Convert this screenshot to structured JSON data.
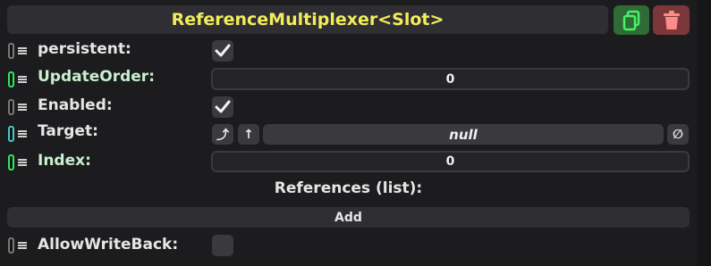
{
  "header": {
    "title": "ReferenceMultiplexer<Slot>",
    "duplicate_icon": "duplicate-icon",
    "delete_icon": "trash-icon"
  },
  "fields": {
    "persistent": {
      "label": "persistent:",
      "checked": true
    },
    "update_order": {
      "label": "UpdateOrder:",
      "value": "0"
    },
    "enabled": {
      "label": "Enabled:",
      "checked": true
    },
    "target": {
      "label": "Target:",
      "value": "null",
      "jump_icon": "jump-icon",
      "up_icon": "up-arrow-icon",
      "clear_icon": "null-icon"
    },
    "index": {
      "label": "Index:",
      "value": "0"
    },
    "references": {
      "label": "References (list):",
      "add_label": "Add"
    },
    "allow_write_back": {
      "label": "AllowWriteBack:",
      "checked": false
    }
  },
  "colors": {
    "title": "#f2ec5b",
    "duplicate_button": "#2e6b35",
    "delete_button": "#7c3838",
    "pill_green": "#2ee85a",
    "pill_cyan": "#46c8c8"
  }
}
